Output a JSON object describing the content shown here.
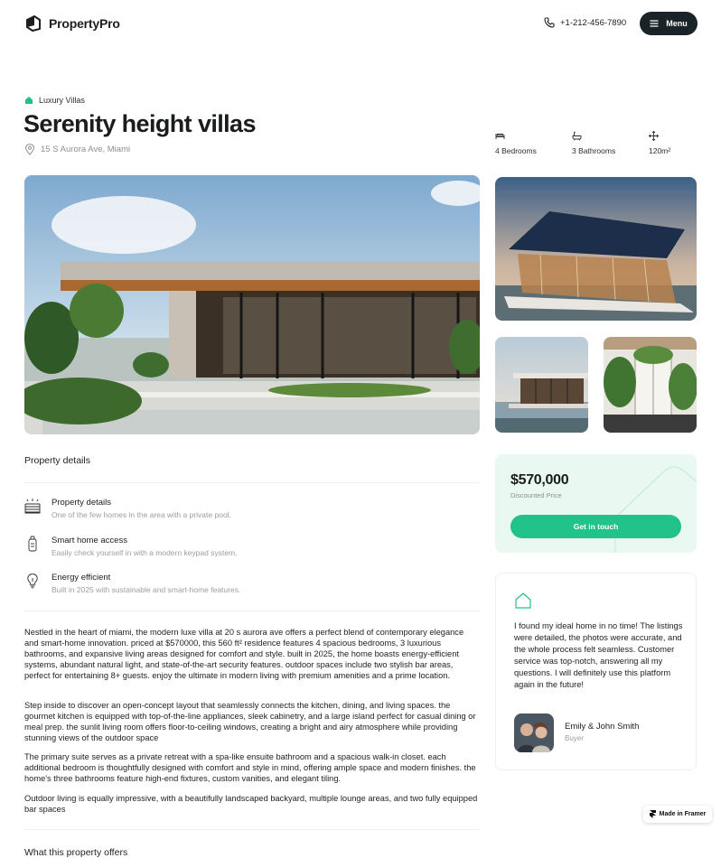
{
  "header": {
    "brand": "PropertyPro",
    "phone": "+1-212-456-7890",
    "menu_label": "Menu"
  },
  "listing": {
    "category": "Luxury Villas",
    "title": "Serenity height villas",
    "address": "15 S Aurora Ave, Miami",
    "specs": [
      {
        "icon": "bed-icon",
        "label": "4 Bedrooms"
      },
      {
        "icon": "bathtub-icon",
        "label": "3 Bathrooms"
      },
      {
        "icon": "area-arrows-icon",
        "label": "120m²"
      }
    ]
  },
  "details": {
    "section_title": "Property details",
    "features": [
      {
        "icon": "pool-icon",
        "title": "Property details",
        "desc": "One of the few homes in the area with a private pool."
      },
      {
        "icon": "keypad-lock-icon",
        "title": "Smart home access",
        "desc": "Easily check yourself in with a modern keypad system."
      },
      {
        "icon": "lightbulb-icon",
        "title": "Energy efficient",
        "desc": "Built in 2025 with sustainable and smart-home features."
      }
    ],
    "paragraphs": [
      "Nestled in the heart of miami, the modern luxe villa at 20 s aurora ave offers a perfect blend of contemporary elegance and smart-home innovation. priced at $570000, this 560 ft² residence features 4 spacious bedrooms, 3 luxurious bathrooms, and expansive living areas designed for comfort and style. built in 2025, the home boasts energy-efficient systems, abundant natural light, and state-of-the-art security features. outdoor spaces include two stylish bar areas, perfect for entertaining 8+ guests. enjoy the ultimate in modern living with premium amenities and a prime location.",
      "Step inside to discover an open-concept layout that seamlessly connects the kitchen, dining, and living spaces. the gourmet kitchen is equipped with top-of-the-line appliances, sleek cabinetry, and a large island perfect for casual dining or meal prep. the sunlit living room offers floor-to-ceiling windows, creating a bright and airy atmosphere while providing stunning views of the outdoor space",
      "The primary suite serves as a private retreat with a spa-like ensuite bathroom and a spacious walk-in closet. each additional bedroom is thoughtfully designed with comfort and style in mind, offering ample space and modern finishes. the home's three bathrooms feature high-end fixtures, custom vanities, and elegant tiling.",
      "Outdoor living is equally impressive, with a beautifully landscaped backyard, multiple lounge areas, and two fully equipped bar spaces"
    ],
    "offers_title": "What this property offers"
  },
  "price_card": {
    "price": "$570,000",
    "sub": "Discounted Price",
    "cta": "Get in touch"
  },
  "testimonial": {
    "quote": "I found my ideal home in no time! The listings were detailed, the photos were accurate, and the whole process felt seamless. Customer service was top-notch, answering all my questions. I will definitely use this platform again in the future!",
    "name": "Emily & John Smith",
    "role": "Buyer"
  },
  "badge": {
    "label": "Made in Framer"
  },
  "colors": {
    "accent": "#22c28b",
    "accent_light": "#e9f8f1",
    "dark": "#1a2327"
  }
}
